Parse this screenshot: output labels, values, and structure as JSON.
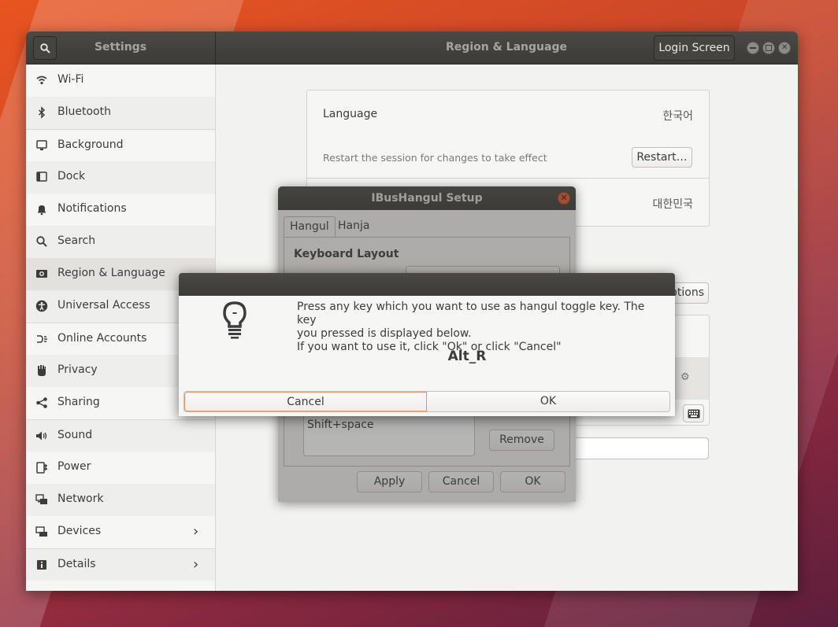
{
  "settings_window": {
    "sidebar_title": "Settings",
    "panel_title": "Region & Language",
    "login_screen_label": "Login Screen"
  },
  "sidebar": {
    "items": [
      {
        "label": "Wi-Fi",
        "icon": "wifi-icon"
      },
      {
        "label": "Bluetooth",
        "icon": "bluetooth-icon"
      },
      {
        "label": "Background",
        "icon": "background-icon"
      },
      {
        "label": "Dock",
        "icon": "dock-icon"
      },
      {
        "label": "Notifications",
        "icon": "bell-icon"
      },
      {
        "label": "Search",
        "icon": "search-icon"
      },
      {
        "label": "Region & Language",
        "icon": "region-icon"
      },
      {
        "label": "Universal Access",
        "icon": "accessibility-icon"
      },
      {
        "label": "Online Accounts",
        "icon": "online-accounts-icon"
      },
      {
        "label": "Privacy",
        "icon": "hand-icon"
      },
      {
        "label": "Sharing",
        "icon": "share-icon"
      },
      {
        "label": "Sound",
        "icon": "speaker-icon"
      },
      {
        "label": "Power",
        "icon": "power-icon"
      },
      {
        "label": "Network",
        "icon": "network-icon"
      },
      {
        "label": "Devices",
        "icon": "devices-icon"
      },
      {
        "label": "Details",
        "icon": "info-icon"
      }
    ]
  },
  "region": {
    "language_label": "Language",
    "language_value": "한국어",
    "restart_hint": "Restart the session for changes to take effect",
    "restart_button": "Restart…",
    "formats_value": "대한민국",
    "options_button": "Options"
  },
  "ibus_setup": {
    "title": "IBusHangul Setup",
    "tabs": [
      "Hangul",
      "Hanja"
    ],
    "keyboard_layout_label": "Keyboard Layout",
    "toggle_key_entry": "Shift+space",
    "remove_button": "Remove",
    "apply_button": "Apply",
    "cancel_button": "Cancel",
    "ok_button": "OK"
  },
  "dialog": {
    "line1": "Press any key which you want to use as hangul toggle key. The key",
    "line2": "you pressed is displayed below.",
    "line3": "If you want to use it, click \"Ok\" or click \"Cancel\"",
    "key_pressed": "Alt_R",
    "cancel_button": "Cancel",
    "ok_button": "OK",
    "icon": "lightbulb-icon"
  },
  "colors": {
    "accent": "#e95420",
    "titlebar": "#3c3b37"
  }
}
